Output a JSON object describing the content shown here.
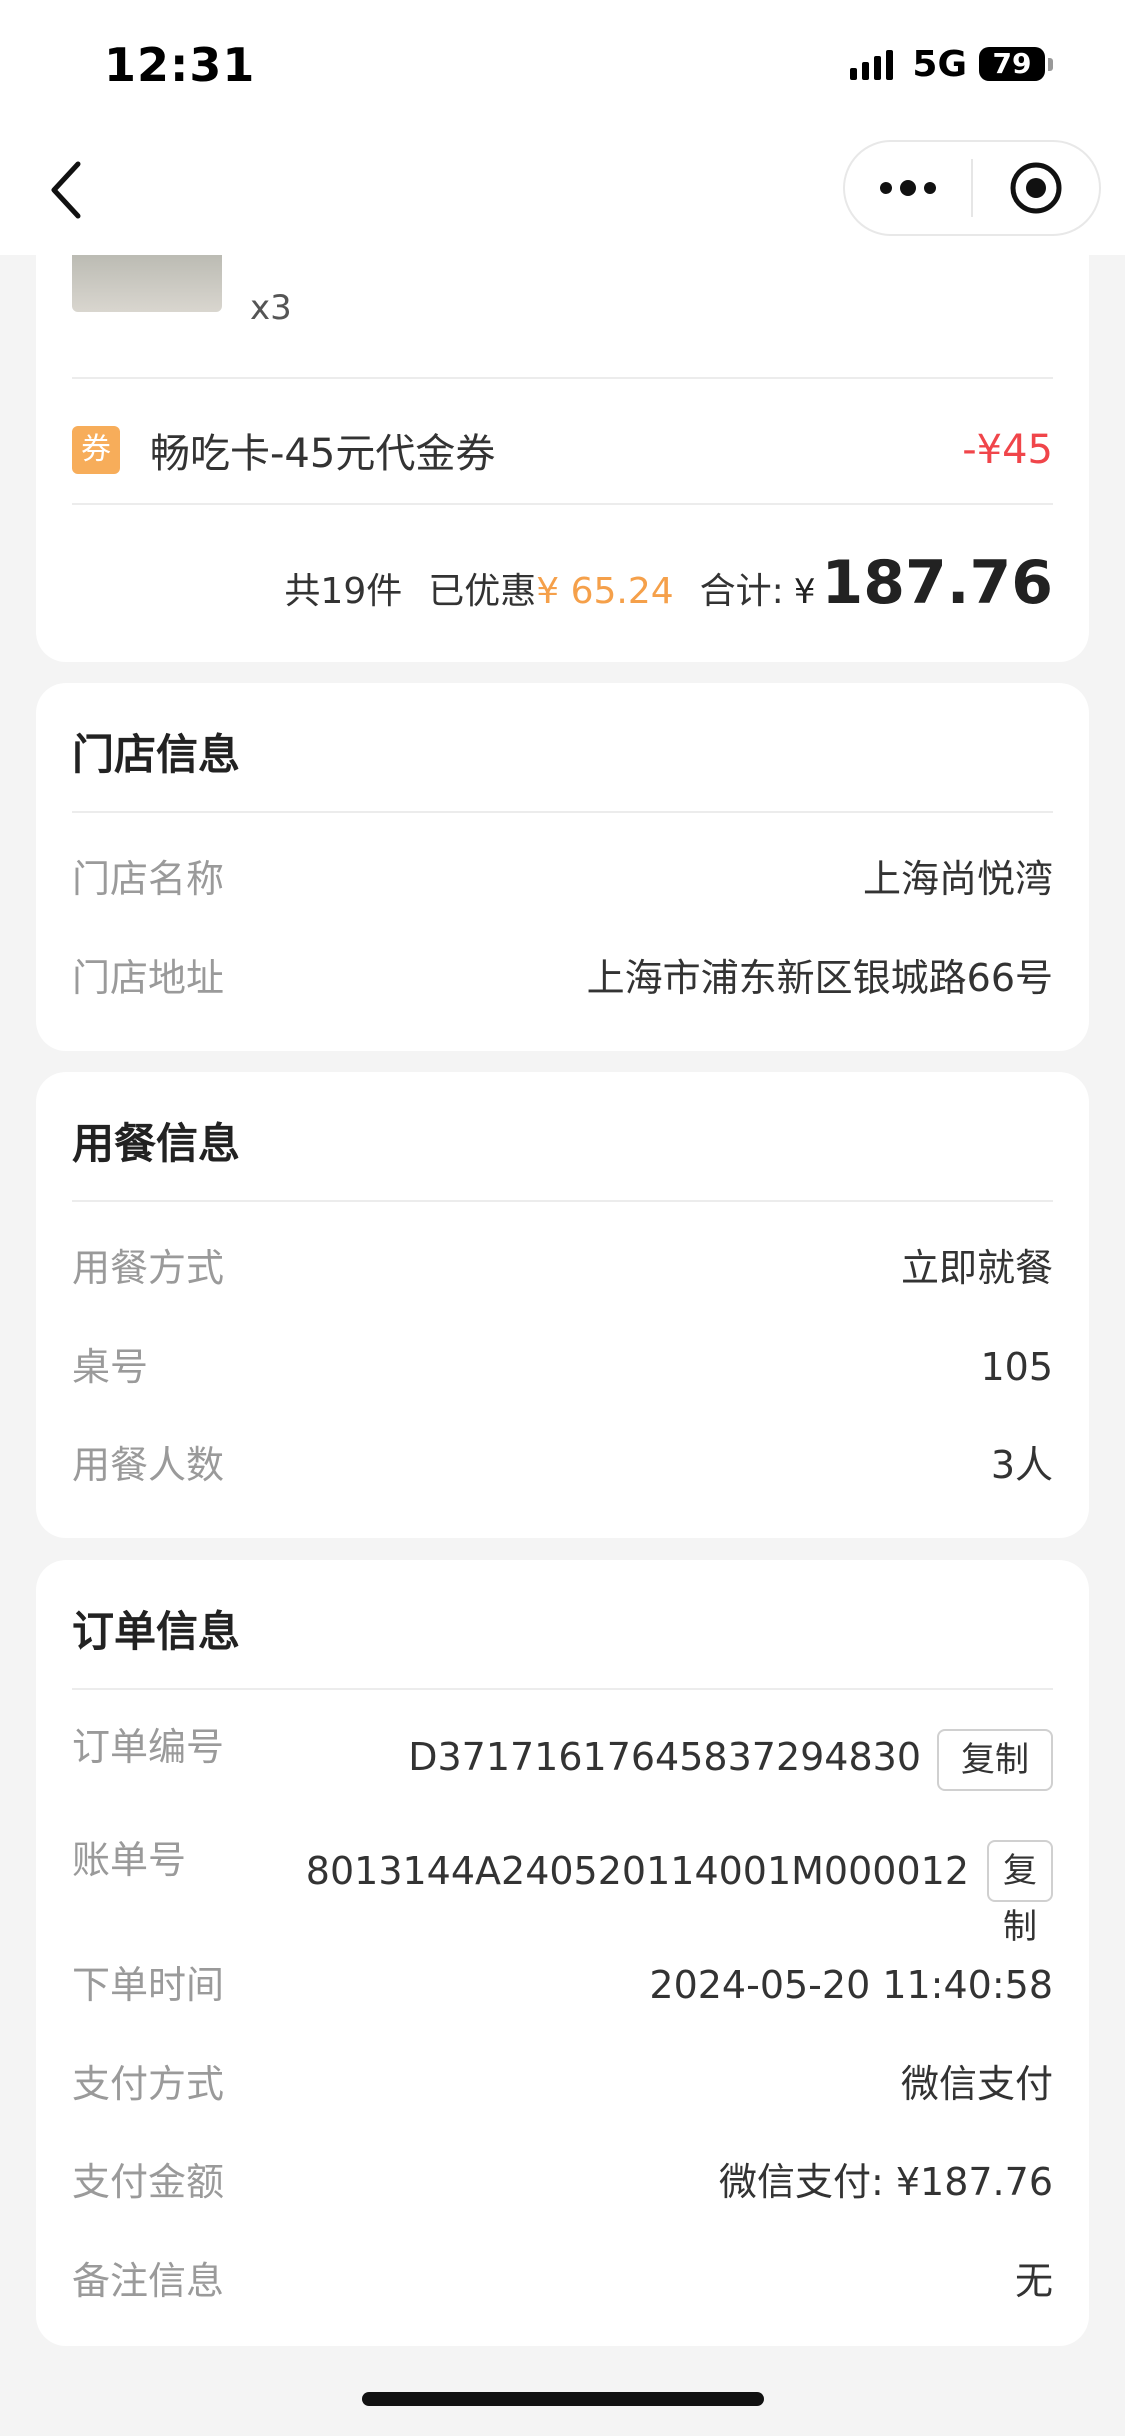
{
  "status_bar": {
    "time": "12:31",
    "network": "5G",
    "battery": "79"
  },
  "nav": {
    "back_icon": "chevron-left-icon",
    "more_icon": "more-dots-icon",
    "close_icon": "target-circle-icon"
  },
  "goods": {
    "quantity": "x3",
    "coupon_icon_text": "券",
    "coupon_name": "畅吃卡-45元代金券",
    "coupon_amount": "-¥45",
    "total_count": "共19件",
    "saved_label": "已优惠",
    "saved_amount": "¥ 65.24",
    "sum_label": "合计:",
    "currency": "¥",
    "sum_amount": "187.76"
  },
  "store": {
    "title": "门店信息",
    "rows": [
      {
        "label": "门店名称",
        "value": "上海尚悦湾"
      },
      {
        "label": "门店地址",
        "value": "上海市浦东新区银城路66号"
      }
    ]
  },
  "dine": {
    "title": "用餐信息",
    "rows": [
      {
        "label": "用餐方式",
        "value": "立即就餐"
      },
      {
        "label": "桌号",
        "value": "105"
      },
      {
        "label": "用餐人数",
        "value": "3人"
      }
    ]
  },
  "order": {
    "title": "订单信息",
    "order_no_label": "订单编号",
    "order_no": "D37171617645837294830",
    "copy_label": "复制",
    "bill_no_label": "账单号",
    "bill_no": "8013144A240520114001M000012",
    "copy_label_first": "复",
    "copy_label_second": "制",
    "rows": [
      {
        "label": "下单时间",
        "value": "2024-05-20 11:40:58"
      },
      {
        "label": "支付方式",
        "value": "微信支付"
      },
      {
        "label": "支付金额",
        "value": "微信支付: ¥187.76"
      },
      {
        "label": "备注信息",
        "value": "无"
      }
    ]
  },
  "colors": {
    "accent_orange": "#f5a04a",
    "discount_red": "#f0454a",
    "coupon_orange": "#f7ad5a"
  }
}
